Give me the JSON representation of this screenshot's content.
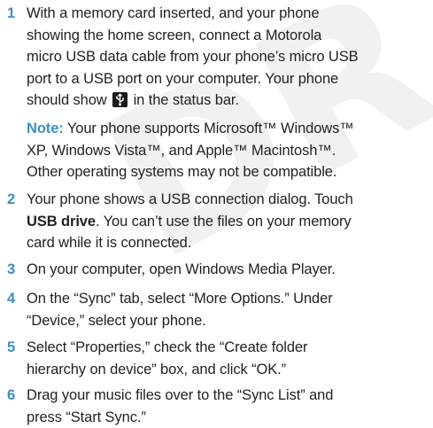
{
  "watermark": "DRAFT",
  "colors": {
    "accent": "#3b8fc6",
    "text": "#222222"
  },
  "steps": [
    {
      "number": "1",
      "lines": [
        "With a memory card inserted, and your phone",
        "showing the home screen, connect a Motorola",
        "micro USB data cable from your phone’s micro USB",
        "port to a USB port on your computer. Your phone"
      ],
      "line5_before": "should show",
      "status_icon": "usb-connection-icon",
      "line5_after": "in the status bar."
    },
    {
      "note_label": "Note:",
      "note_line1": "Your phone supports Microsoft™ Windows™",
      "note_lines": [
        "XP, Windows Vista™, and Apple™ Macintosh™.",
        "Other operating systems may not be compatible."
      ]
    },
    {
      "number": "2",
      "line1": "Your phone shows a USB connection dialog. Touch",
      "bold_term": "USB drive",
      "line2_rest": ". You can’t use the files on your memory",
      "line3": "card while it is connected."
    },
    {
      "number": "3",
      "lines": [
        "On your computer, open Windows Media Player."
      ]
    },
    {
      "number": "4",
      "lines": [
        "On the “Sync” tab, select “More Options.” Under",
        "“Device,” select your phone."
      ]
    },
    {
      "number": "5",
      "lines": [
        "Select “Properties,” check the “Create folder",
        "hierarchy on device” box, and click “OK.”"
      ]
    },
    {
      "number": "6",
      "lines": [
        "Drag your music files over to the “Sync List” and",
        "press “Start Sync.”"
      ]
    }
  ]
}
